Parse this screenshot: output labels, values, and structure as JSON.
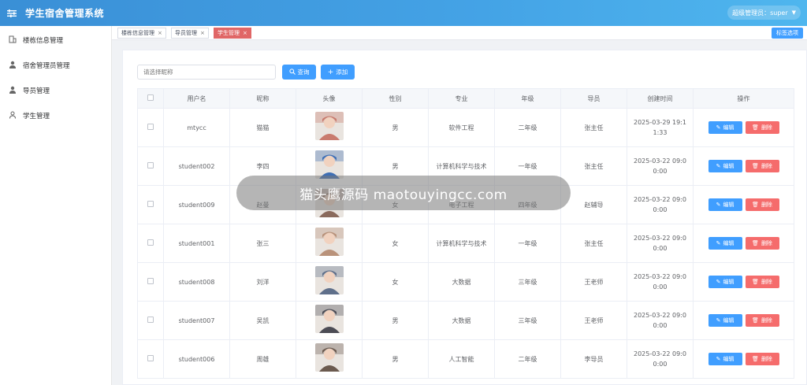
{
  "header": {
    "title": "学生宿舍管理系统",
    "user": "超级管理员：super"
  },
  "sidebar": {
    "items": [
      {
        "label": "楼栋信息管理",
        "icon": "building-icon"
      },
      {
        "label": "宿舍管理员管理",
        "icon": "user-icon"
      },
      {
        "label": "导员管理",
        "icon": "user-icon"
      },
      {
        "label": "学生管理",
        "icon": "user-outline-icon"
      }
    ]
  },
  "tabs": [
    {
      "label": "楼栋信息管理",
      "close": "×"
    },
    {
      "label": "导员管理",
      "close": "×"
    },
    {
      "label": "学生管理",
      "close": "×"
    }
  ],
  "tab_options": "标签选项",
  "toolbar": {
    "search_placeholder": "请选择昵称",
    "query_label": "查询",
    "add_label": "添加"
  },
  "table": {
    "columns": [
      "用户名",
      "昵称",
      "头像",
      "性别",
      "专业",
      "年级",
      "导员",
      "创建时间",
      "操作"
    ],
    "edit_label": "编辑",
    "delete_label": "删除",
    "rows": [
      {
        "username": "mtycc",
        "nickname": "猫猫",
        "gender": "男",
        "major": "软件工程",
        "grade": "二年级",
        "counselor": "张主任",
        "created": "2025-03-29 19:11:33"
      },
      {
        "username": "student002",
        "nickname": "李四",
        "gender": "男",
        "major": "计算机科学与技术",
        "grade": "一年级",
        "counselor": "张主任",
        "created": "2025-03-22 09:00:00"
      },
      {
        "username": "student009",
        "nickname": "赵曼",
        "gender": "女",
        "major": "电子工程",
        "grade": "四年级",
        "counselor": "赵辅导",
        "created": "2025-03-22 09:00:00"
      },
      {
        "username": "student001",
        "nickname": "张三",
        "gender": "女",
        "major": "计算机科学与技术",
        "grade": "一年级",
        "counselor": "张主任",
        "created": "2025-03-22 09:00:00"
      },
      {
        "username": "student008",
        "nickname": "刘洋",
        "gender": "女",
        "major": "大数据",
        "grade": "三年级",
        "counselor": "王老师",
        "created": "2025-03-22 09:00:00"
      },
      {
        "username": "student007",
        "nickname": "吴凯",
        "gender": "男",
        "major": "大数据",
        "grade": "三年级",
        "counselor": "王老师",
        "created": "2025-03-22 09:00:00"
      },
      {
        "username": "student006",
        "nickname": "周雄",
        "gender": "男",
        "major": "人工智能",
        "grade": "二年级",
        "counselor": "李导员",
        "created": "2025-03-22 09:00:00"
      }
    ]
  },
  "watermark": "猫头鹰源码 maotouyingcc.com",
  "colors": {
    "header": "#3a8fd6",
    "primary": "#409eff",
    "danger": "#f56c6c",
    "active_tab": "#e06666"
  }
}
